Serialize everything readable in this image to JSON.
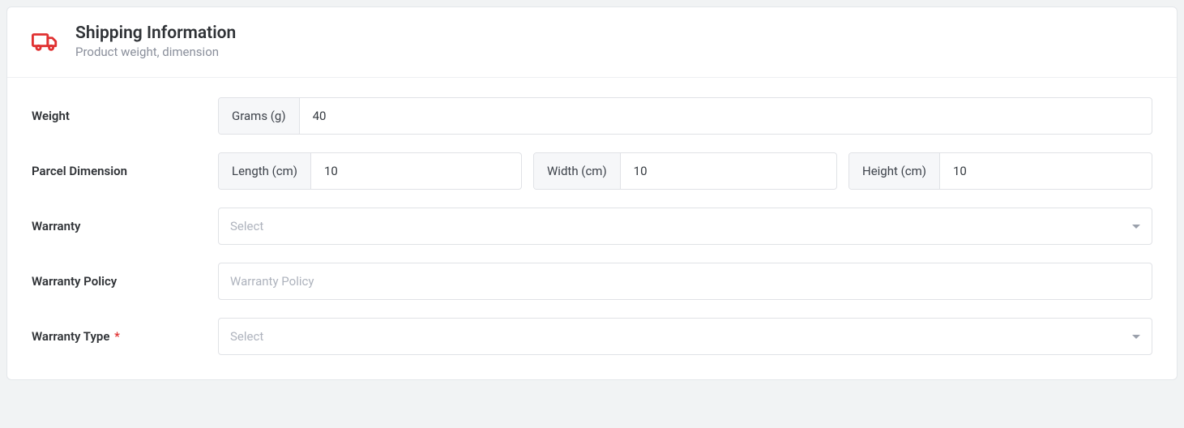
{
  "header": {
    "title": "Shipping Information",
    "subtitle": "Product weight, dimension"
  },
  "form": {
    "weight": {
      "label": "Weight",
      "unit_label": "Grams (g)",
      "value": "40"
    },
    "dimension": {
      "label": "Parcel Dimension",
      "length": {
        "label": "Length (cm)",
        "value": "10"
      },
      "width": {
        "label": "Width (cm)",
        "value": "10"
      },
      "height": {
        "label": "Height (cm)",
        "value": "10"
      }
    },
    "warranty": {
      "label": "Warranty",
      "placeholder": "Select",
      "value": ""
    },
    "warranty_policy": {
      "label": "Warranty Policy",
      "placeholder": "Warranty Policy",
      "value": ""
    },
    "warranty_type": {
      "label": "Warranty Type",
      "required_mark": "*",
      "placeholder": "Select",
      "value": ""
    }
  }
}
